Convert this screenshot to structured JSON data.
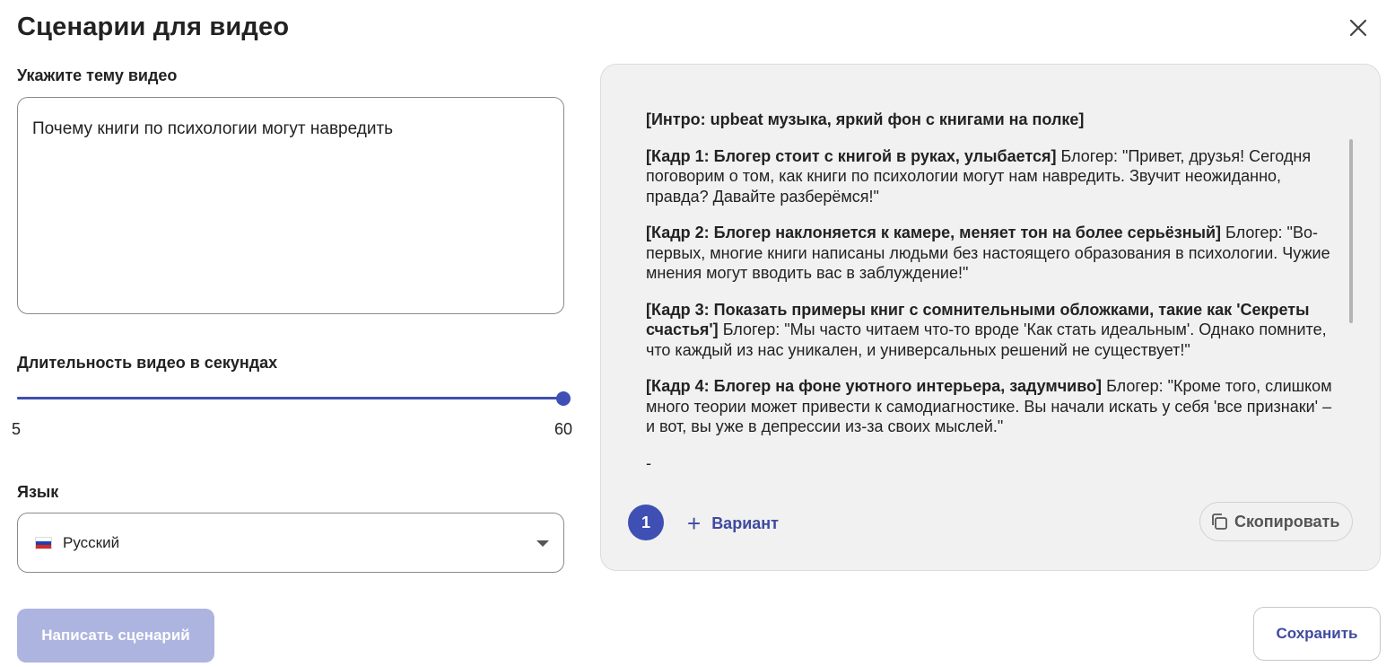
{
  "title": "Сценарии для видео",
  "topic": {
    "label": "Укажите тему видео",
    "value": "Почему книги по психологии могут навредить"
  },
  "duration": {
    "label": "Длительность видео в секундах",
    "min": "5",
    "max": "60",
    "value": 60
  },
  "language": {
    "label": "Язык",
    "value": "Русский",
    "flag_colors": [
      "#ffffff",
      "#1c3fb8",
      "#d52b1e"
    ]
  },
  "actions": {
    "write_label": "Написать сценарий",
    "save_label": "Сохранить"
  },
  "result": {
    "paragraphs": [
      {
        "bold": "[Интро: upbeat музыка, яркий фон с книгами на полке]",
        "text": ""
      },
      {
        "bold": "[Кадр 1: Блогер стоит с книгой в руках, улыбается]",
        "text": " Блогер: \"Привет, друзья! Сегодня поговорим о том, как книги по психологии могут нам навредить. Звучит неожиданно, правда? Давайте разберёмся!\""
      },
      {
        "bold": "[Кадр 2: Блогер наклоняется к камере, меняет тон на более серьёзный]",
        "text": " Блогер: \"Во-первых, многие книги написаны людьми без настоящего образования в психологии. Чужие мнения могут вводить вас в заблуждение!\""
      },
      {
        "bold": "[Кадр 3: Показать примеры книг с сомнительными обложками, такие как 'Секреты счастья']",
        "text": " Блогер: \"Мы часто читаем что-то вроде 'Как стать идеальным'. Однако помните, что каждый из нас уникален, и универсальных решений не существует!\""
      },
      {
        "bold": "[Кадр 4: Блогер на фоне уютного интерьера, задумчиво]",
        "text": " Блогер: \"Кроме того, слишком много теории может привести к самодиагностике. Вы начали искать у себя 'все признаки' – и вот, вы уже в депрессии из-за своих мыслей.\""
      },
      {
        "bold": "",
        "text": "-"
      }
    ],
    "variant_number": "1",
    "add_variant_label": "Вариант",
    "copy_label": "Скопировать"
  },
  "icons": {
    "close": "close-icon",
    "plus": "plus-icon",
    "copy": "copy-icon",
    "dropdown": "chevron-down-icon",
    "flag": "russia-flag-icon"
  }
}
